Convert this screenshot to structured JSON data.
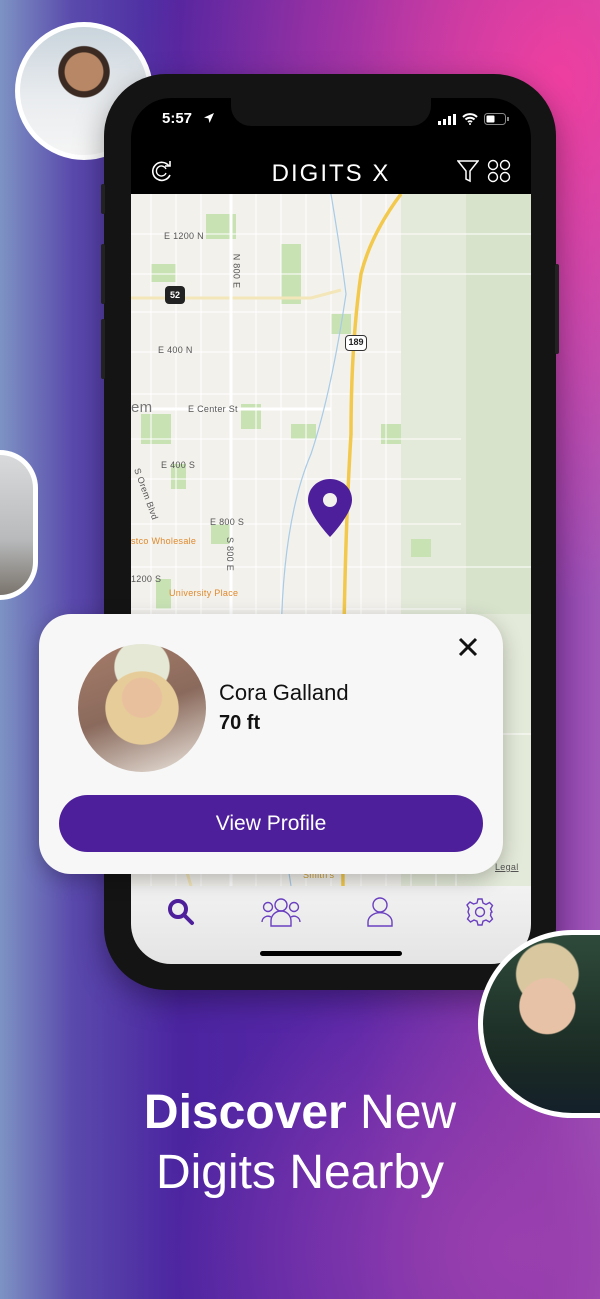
{
  "status_bar": {
    "time": "5:57"
  },
  "header": {
    "title": "DIGITS X",
    "icons": [
      "refresh-icon",
      "filter-icon",
      "grid-icon"
    ]
  },
  "map": {
    "labels": [
      "E 1200 N",
      "N 800 E",
      "E 400 N",
      "em",
      "E Center St",
      "E 400 S",
      "S Orem Blvd",
      "E 800 S",
      "S 800 E",
      "stco Wholesale",
      "1200 S",
      "University Place",
      "Smith's",
      "Legal"
    ],
    "route_shields": [
      "52",
      "189"
    ],
    "pin_color": "#4e1f9b"
  },
  "profile_card": {
    "name": "Cora Galland",
    "distance": "70 ft",
    "button_label": "View Profile"
  },
  "tab_bar": {
    "tabs": [
      "search",
      "groups",
      "profile",
      "settings"
    ],
    "active": "search",
    "accent": "#4e1f9b"
  },
  "headline": {
    "bold": "Discover",
    "rest_line1": "New",
    "line2": "Digits Nearby"
  }
}
